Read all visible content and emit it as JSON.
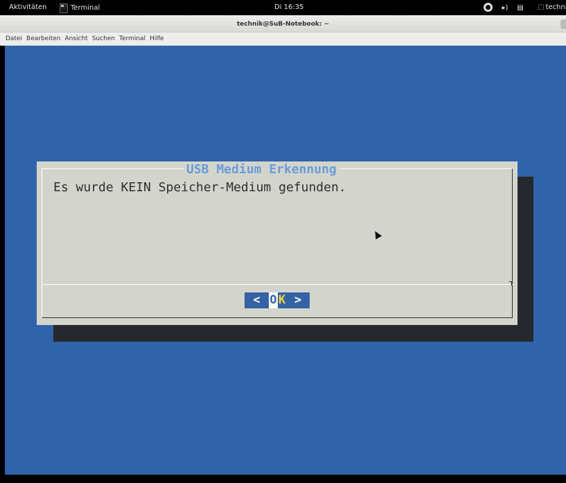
{
  "topbar": {
    "activities": "Aktivitäten",
    "app_name": "Terminal",
    "clock": "Di 16:35",
    "user": "techni",
    "icons": [
      "accessibility-icon",
      "volume-icon",
      "network-icon",
      "chat-icon"
    ]
  },
  "window": {
    "title": "technik@SuB-Notebook: ~"
  },
  "menubar": {
    "items": [
      "Datei",
      "Bearbeiten",
      "Ansicht",
      "Suchen",
      "Terminal",
      "Hilfe"
    ]
  },
  "dialog": {
    "title": "USB Medium Erkennung",
    "message": "Es wurde KEIN Speicher-Medium gefunden.",
    "ok": {
      "left": "<",
      "o": "O",
      "k": "K",
      "right": ">"
    }
  },
  "colors": {
    "terminal_bg": "#3064a9",
    "dialog_bg": "#d3d5cd",
    "title_fg": "#6a9bd8",
    "button_bg": "#3463a5",
    "hotkey_fg": "#f3d633"
  }
}
